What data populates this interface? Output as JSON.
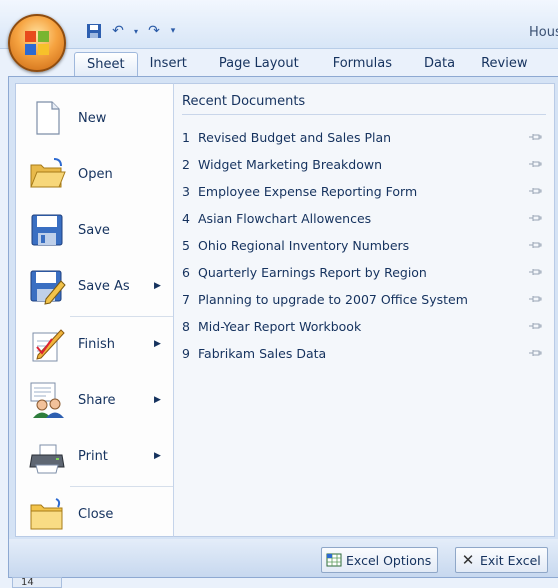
{
  "window": {
    "title": "Hous"
  },
  "ribbon": {
    "tabs": [
      {
        "label": "Sheet"
      },
      {
        "label": "Insert"
      },
      {
        "label": "Page Layout"
      },
      {
        "label": "Formulas"
      },
      {
        "label": "Data"
      },
      {
        "label": "Review"
      }
    ]
  },
  "office_menu": {
    "items": [
      {
        "label": "New",
        "icon": "new-document-icon"
      },
      {
        "label": "Open",
        "icon": "open-folder-icon"
      },
      {
        "label": "Save",
        "icon": "save-disk-icon"
      },
      {
        "label": "Save As",
        "icon": "save-as-icon"
      },
      {
        "label": "Finish",
        "icon": "finish-pen-icon"
      },
      {
        "label": "Share",
        "icon": "share-people-icon"
      },
      {
        "label": "Print",
        "icon": "printer-icon"
      },
      {
        "label": "Close",
        "icon": "close-folder-icon"
      }
    ],
    "recent_title": "Recent Documents",
    "recent": [
      {
        "num": "1",
        "name": "Revised Budget and Sales Plan"
      },
      {
        "num": "2",
        "name": "Widget Marketing Breakdown"
      },
      {
        "num": "3",
        "name": "Employee Expense Reporting Form"
      },
      {
        "num": "4",
        "name": "Asian Flowchart Allowences"
      },
      {
        "num": "5",
        "name": "Ohio Regional Inventory Numbers"
      },
      {
        "num": "6",
        "name": "Quarterly Earnings Report by Region"
      },
      {
        "num": "7",
        "name": "Planning to upgrade to 2007 Office System"
      },
      {
        "num": "8",
        "name": "Mid-Year Report Workbook"
      },
      {
        "num": "9",
        "name": "Fabrikam Sales Data"
      }
    ],
    "excel_options": "Excel Options",
    "exit_excel": "Exit Excel"
  },
  "grid": {
    "row_number": "14"
  }
}
